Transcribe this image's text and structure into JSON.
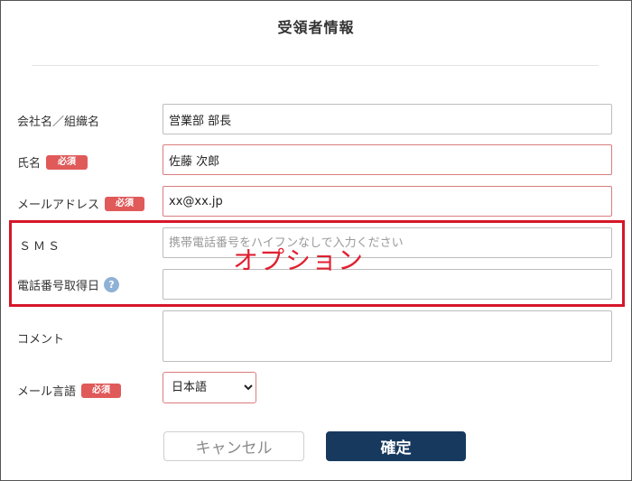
{
  "form": {
    "title": "受領者情報",
    "required_badge": "必須",
    "help_symbol": "?",
    "fields": {
      "company": {
        "label": "会社名／組織名",
        "value": "営業部 部長"
      },
      "name": {
        "label": "氏名",
        "value": "佐藤 次郎"
      },
      "email": {
        "label": "メールアドレス",
        "value": "xx@xx.jp"
      },
      "sms": {
        "label": "ＳＭＳ",
        "value": "",
        "placeholder": "携帯電話番号をハイフンなしで入力ください"
      },
      "phone_date": {
        "label": "電話番号取得日",
        "value": ""
      },
      "comment": {
        "label": "コメント",
        "value": ""
      },
      "mail_lang": {
        "label": "メール言語",
        "selected": "日本語"
      }
    },
    "buttons": {
      "cancel": "キャンセル",
      "confirm": "確定"
    }
  },
  "annotation": {
    "text": "オプション",
    "color": "#d6162a"
  },
  "colors": {
    "required_badge": "#e05a5a",
    "confirm_button": "#17395e",
    "help_icon": "#8fb1d6"
  }
}
